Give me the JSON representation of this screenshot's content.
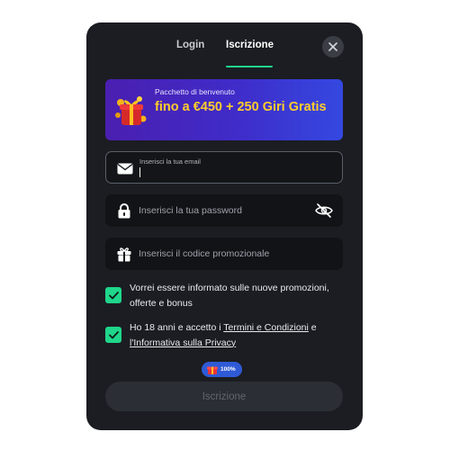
{
  "tabs": {
    "login": "Login",
    "signup": "Iscrizione"
  },
  "banner": {
    "subtitle": "Pacchetto di benvenuto",
    "headline": "fino a €450 + 250 Giri Gratis"
  },
  "form": {
    "email_label": "Inserisci la tua email",
    "password_placeholder": "Inserisci la tua password",
    "promo_placeholder": "Inserisci il codice promozionale"
  },
  "consents": {
    "newsletter": "Vorrei essere informato sulle nuove promozioni, offerte e bonus",
    "age_prefix": "Ho 18 anni e accetto i ",
    "terms_link": "Termini e Condizioni",
    "and": " e ",
    "privacy_link": "l'Informativa sulla Privacy"
  },
  "progress": {
    "value": "100%"
  },
  "submit_label": "Iscrizione",
  "colors": {
    "accent": "#1fd68b",
    "bonus": "#ffcd2b",
    "modal_bg": "#1b1d22"
  },
  "icons": [
    "close-icon",
    "gift-icon",
    "envelope-icon",
    "lock-icon",
    "eye-off-icon",
    "present-icon",
    "check-icon"
  ]
}
